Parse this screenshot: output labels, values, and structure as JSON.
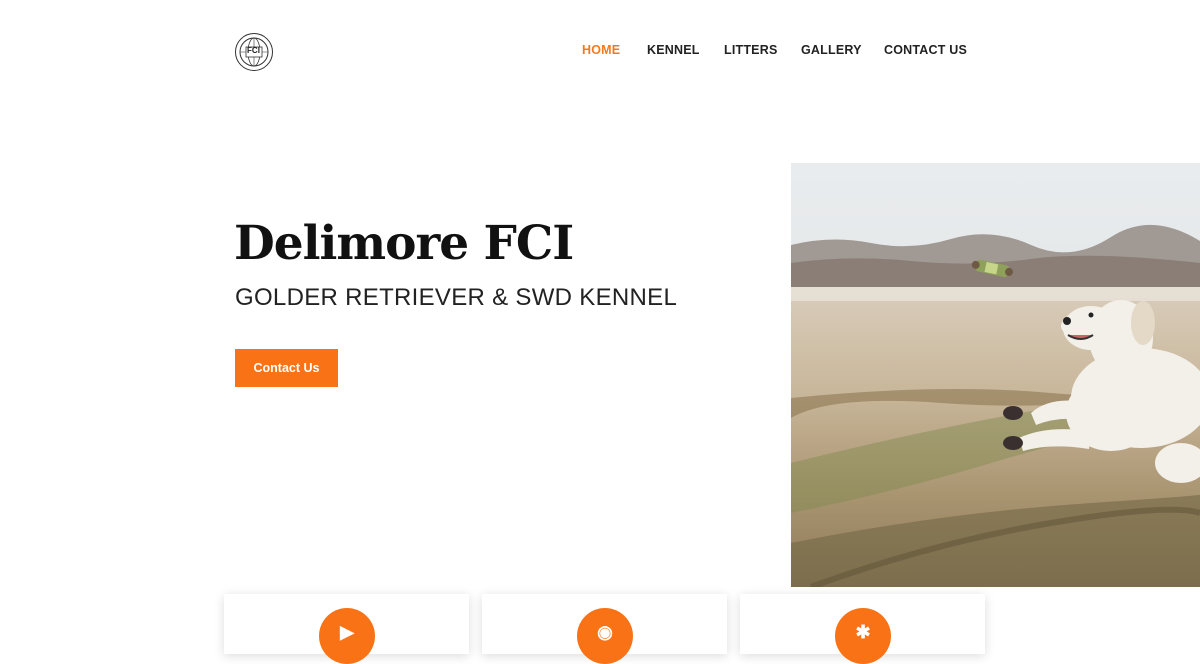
{
  "header": {
    "logo_text": "FCI",
    "nav": [
      {
        "label": "HOME",
        "active": true
      },
      {
        "label": "KENNEL",
        "active": false
      },
      {
        "label": "LITTERS",
        "active": false
      },
      {
        "label": "GALLERY",
        "active": false
      },
      {
        "label": "CONTACT US",
        "active": false
      }
    ]
  },
  "hero": {
    "title": "Delimore FCI",
    "subtitle": "GOLDER RETRIEVER & SWD KENNEL",
    "cta_label": "Contact Us",
    "image_subject": "white golden retriever jumping to catch a toy in a field"
  },
  "colors": {
    "accent": "#f97316",
    "nav_active": "#f47a1f",
    "text": "#111111"
  },
  "feature_cards": [
    {
      "icon": "play-icon"
    },
    {
      "icon": "location-pin-icon"
    },
    {
      "icon": "paw-icon"
    }
  ]
}
